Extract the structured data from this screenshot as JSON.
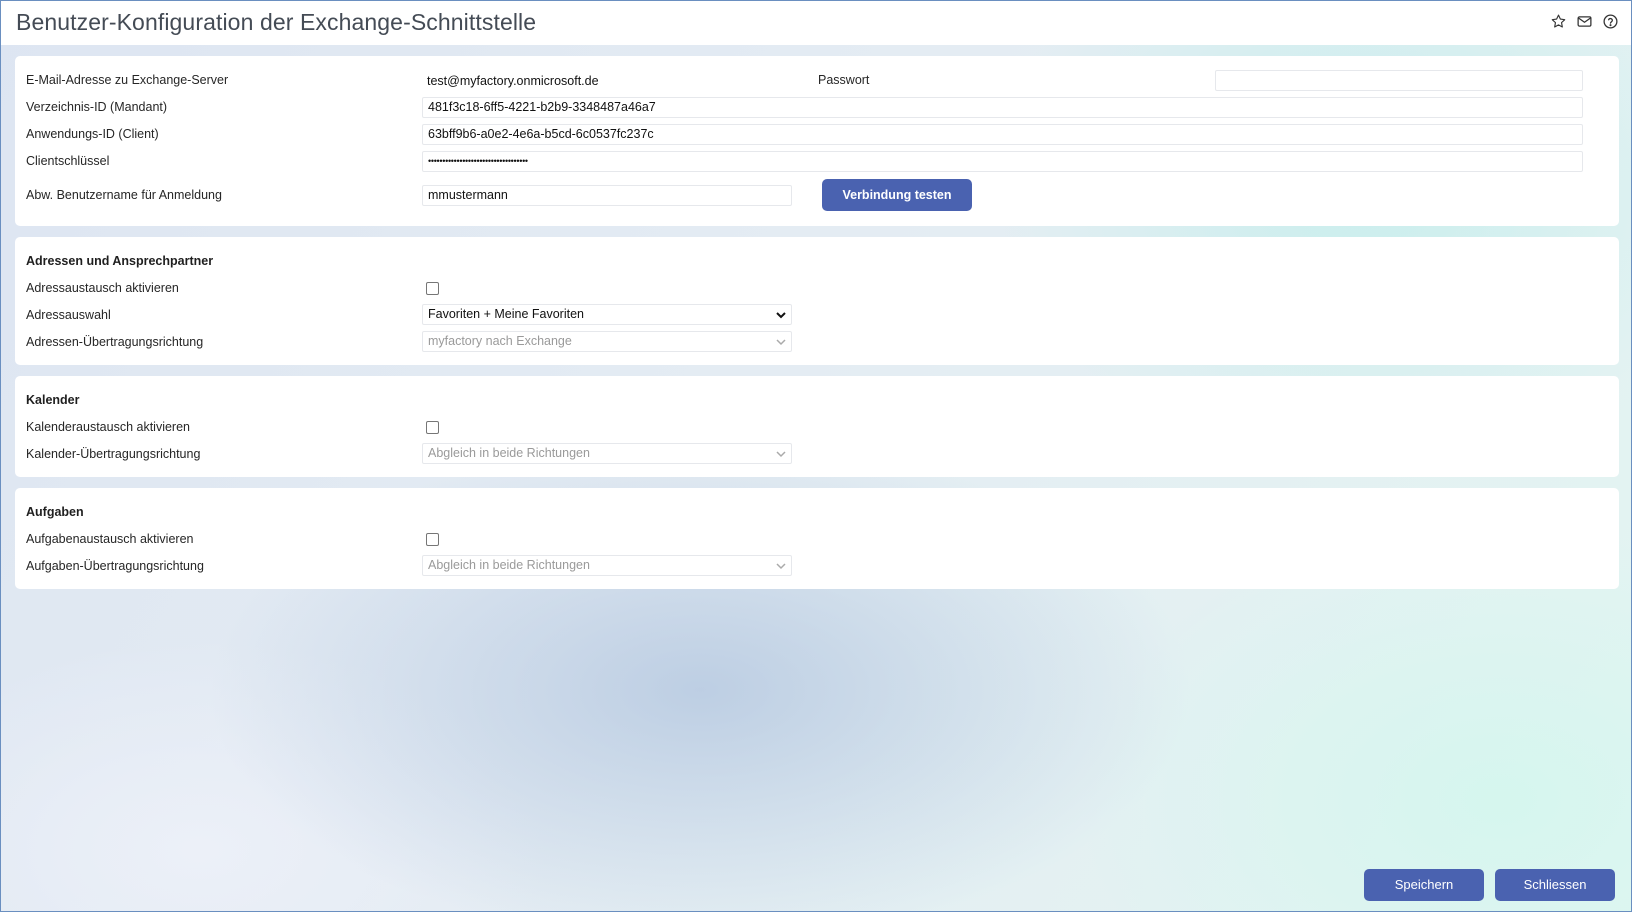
{
  "header": {
    "title": "Benutzer-Konfiguration der Exchange-Schnittstelle",
    "icons": [
      "star-icon",
      "mail-icon",
      "help-icon"
    ]
  },
  "connection": {
    "email_label": "E-Mail-Adresse zu Exchange-Server",
    "email_value": "test@myfactory.onmicrosoft.de",
    "password_label": "Passwort",
    "password_value": "",
    "directory_label": "Verzeichnis-ID (Mandant)",
    "directory_value": "481f3c18-6ff5-4221-b2b9-3348487a46a7",
    "app_label": "Anwendungs-ID (Client)",
    "app_value": "63bff9b6-a0e2-4e6a-b5cd-6c0537fc237c",
    "secret_label": "Clientschlüssel",
    "secret_value": "•••••••••••••••••••••••••••••••••••",
    "username_label": "Abw. Benutzername für Anmeldung",
    "username_value": "mmustermann",
    "test_button": "Verbindung testen"
  },
  "addresses": {
    "title": "Adressen und Ansprechpartner",
    "enable_label": "Adressaustausch aktivieren",
    "enable_checked": false,
    "selection_label": "Adressauswahl",
    "selection_value": "Favoriten + Meine Favoriten",
    "direction_label": "Adressen-Übertragungsrichtung",
    "direction_value": "myfactory nach Exchange"
  },
  "calendar": {
    "title": "Kalender",
    "enable_label": "Kalenderaustausch aktivieren",
    "enable_checked": false,
    "direction_label": "Kalender-Übertragungsrichtung",
    "direction_value": "Abgleich in beide Richtungen"
  },
  "tasks": {
    "title": "Aufgaben",
    "enable_label": "Aufgabenaustausch aktivieren",
    "enable_checked": false,
    "direction_label": "Aufgaben-Übertragungsrichtung",
    "direction_value": "Abgleich in beide Richtungen"
  },
  "footer": {
    "save_button": "Speichern",
    "close_button": "Schliessen"
  },
  "colors": {
    "accent": "#4a62b0",
    "title": "#444b55"
  }
}
